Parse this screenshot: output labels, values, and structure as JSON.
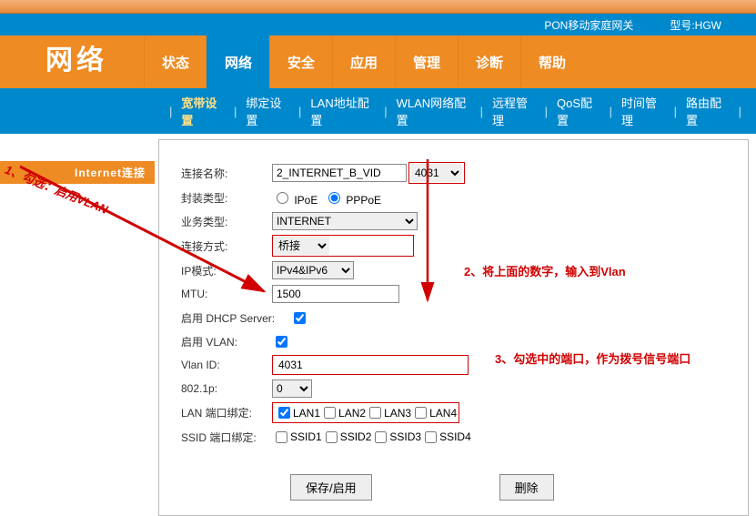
{
  "topbar": {
    "title": "PON移动家庭网关",
    "model_label": "型号:HGW"
  },
  "brand": "网络",
  "tabs": [
    {
      "label": "状态"
    },
    {
      "label": "网络",
      "active": true
    },
    {
      "label": "安全"
    },
    {
      "label": "应用"
    },
    {
      "label": "管理"
    },
    {
      "label": "诊断"
    },
    {
      "label": "帮助"
    }
  ],
  "subnav": [
    "宽带设置",
    "绑定设置",
    "LAN地址配置",
    "WLAN网络配置",
    "远程管理",
    "QoS配置",
    "时间管理",
    "路由配置"
  ],
  "left": {
    "tab": "Internet连接"
  },
  "form": {
    "conn_name_label": "连接名称:",
    "conn_name_value": "2_INTERNET_B_VID",
    "conn_name_suffix": "4031",
    "enc_label": "封装类型:",
    "enc_ipoe": "IPoE",
    "enc_pppoe": "PPPoE",
    "biz_label": "业务类型:",
    "biz_value": "INTERNET",
    "mode_label": "连接方式:",
    "mode_value": "桥接",
    "ip_label": "IP模式:",
    "ip_value": "IPv4&IPv6",
    "mtu_label": "MTU:",
    "mtu_value": "1500",
    "dhcp_label": "启用 DHCP Server:",
    "vlan_enable_label": "启用 VLAN:",
    "vlan_id_label": "Vlan ID:",
    "vlan_id_value": "4031",
    "dot1p_label": "802.1p:",
    "dot1p_value": "0",
    "lan_label": "LAN 端口绑定:",
    "lan": [
      "LAN1",
      "LAN2",
      "LAN3",
      "LAN4"
    ],
    "ssid_label": "SSID 端口绑定:",
    "ssid": [
      "SSID1",
      "SSID2",
      "SSID3",
      "SSID4"
    ]
  },
  "buttons": {
    "save": "保存/启用",
    "delete": "删除"
  },
  "annotations": {
    "a1": "1、勾选：启用VLAN",
    "a2": "2、将上面的数字，输入到Vlan",
    "a3": "3、勾选中的端口，作为拨号信号端口"
  }
}
